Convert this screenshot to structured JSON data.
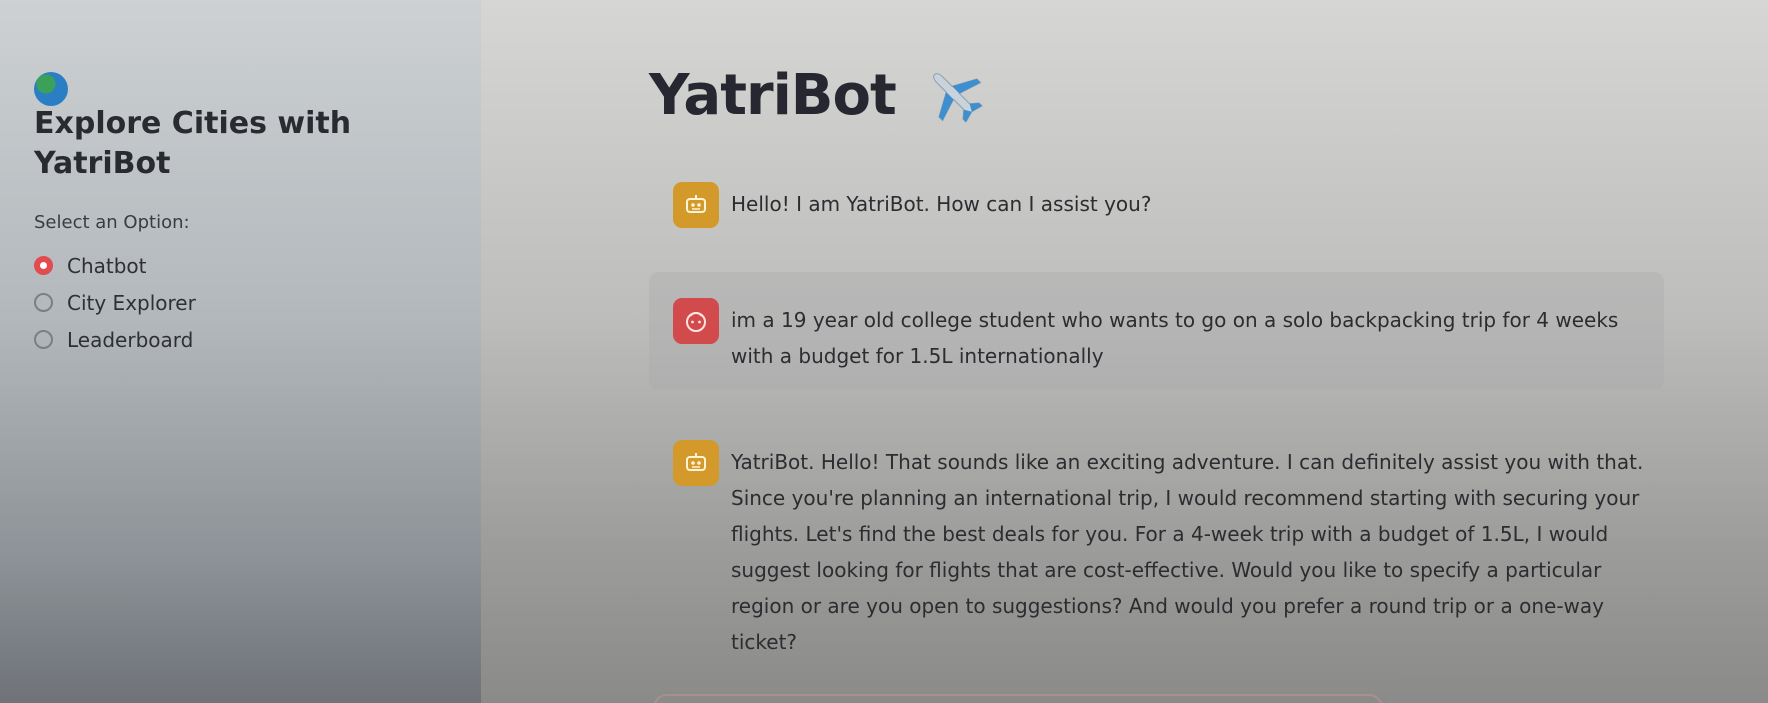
{
  "sidebar": {
    "title": "Explore Cities with YatriBot",
    "title_icon": "globe-icon",
    "radio_label": "Select an Option:",
    "options": [
      {
        "label": "Chatbot",
        "selected": true
      },
      {
        "label": "City Explorer",
        "selected": false
      },
      {
        "label": "Leaderboard",
        "selected": false
      }
    ],
    "accent_color": "#e24b4f"
  },
  "main": {
    "title": "YatriBot",
    "title_icon": "airplane-icon",
    "messages": [
      {
        "role": "assistant",
        "avatar": "robot-icon",
        "text": "Hello! I am YatriBot. How can I assist you?"
      },
      {
        "role": "user",
        "avatar": "user-face-icon",
        "text": "im a 19 year old college student who wants to go on a solo backpacking trip for 4 weeks with a budget for 1.5L internationally"
      },
      {
        "role": "assistant",
        "avatar": "robot-icon",
        "text": "YatriBot. Hello! That sounds like an exciting adventure. I can definitely assist you with that. Since you're planning an international trip, I would recommend starting with securing your flights. Let's find the best deals for you. For a 4-week trip with a budget of 1.5L, I would suggest looking for flights that are cost-effective. Would you like to specify a particular region or are you open to suggestions? And would you prefer a round trip or a one-way ticket?"
      }
    ],
    "bot_avatar_color": "#d39a2b",
    "user_avatar_color": "#d24b4c"
  }
}
